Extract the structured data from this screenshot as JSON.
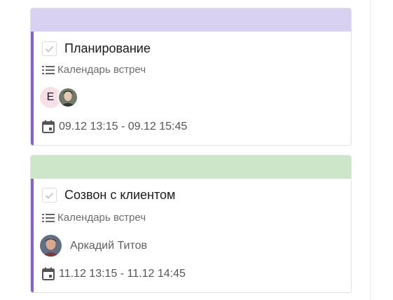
{
  "cards": [
    {
      "header_color": "#d9d1f1",
      "title": "Планирование",
      "calendar": "Календарь встреч",
      "avatar_letter": "Е",
      "date_range": "09.12 13:15 - 09.12 15:45"
    },
    {
      "header_color": "#cde5c8",
      "title": "Созвон с клиентом",
      "calendar": "Календарь встреч",
      "person_name": "Аркадий Титов",
      "date_range": "11.12 13:15 - 11.12 14:45"
    }
  ],
  "accent_color": "#8a5fd1",
  "icons": {
    "checkbox": "check-icon",
    "calendar_list": "list-icon",
    "date": "calendar-icon"
  }
}
